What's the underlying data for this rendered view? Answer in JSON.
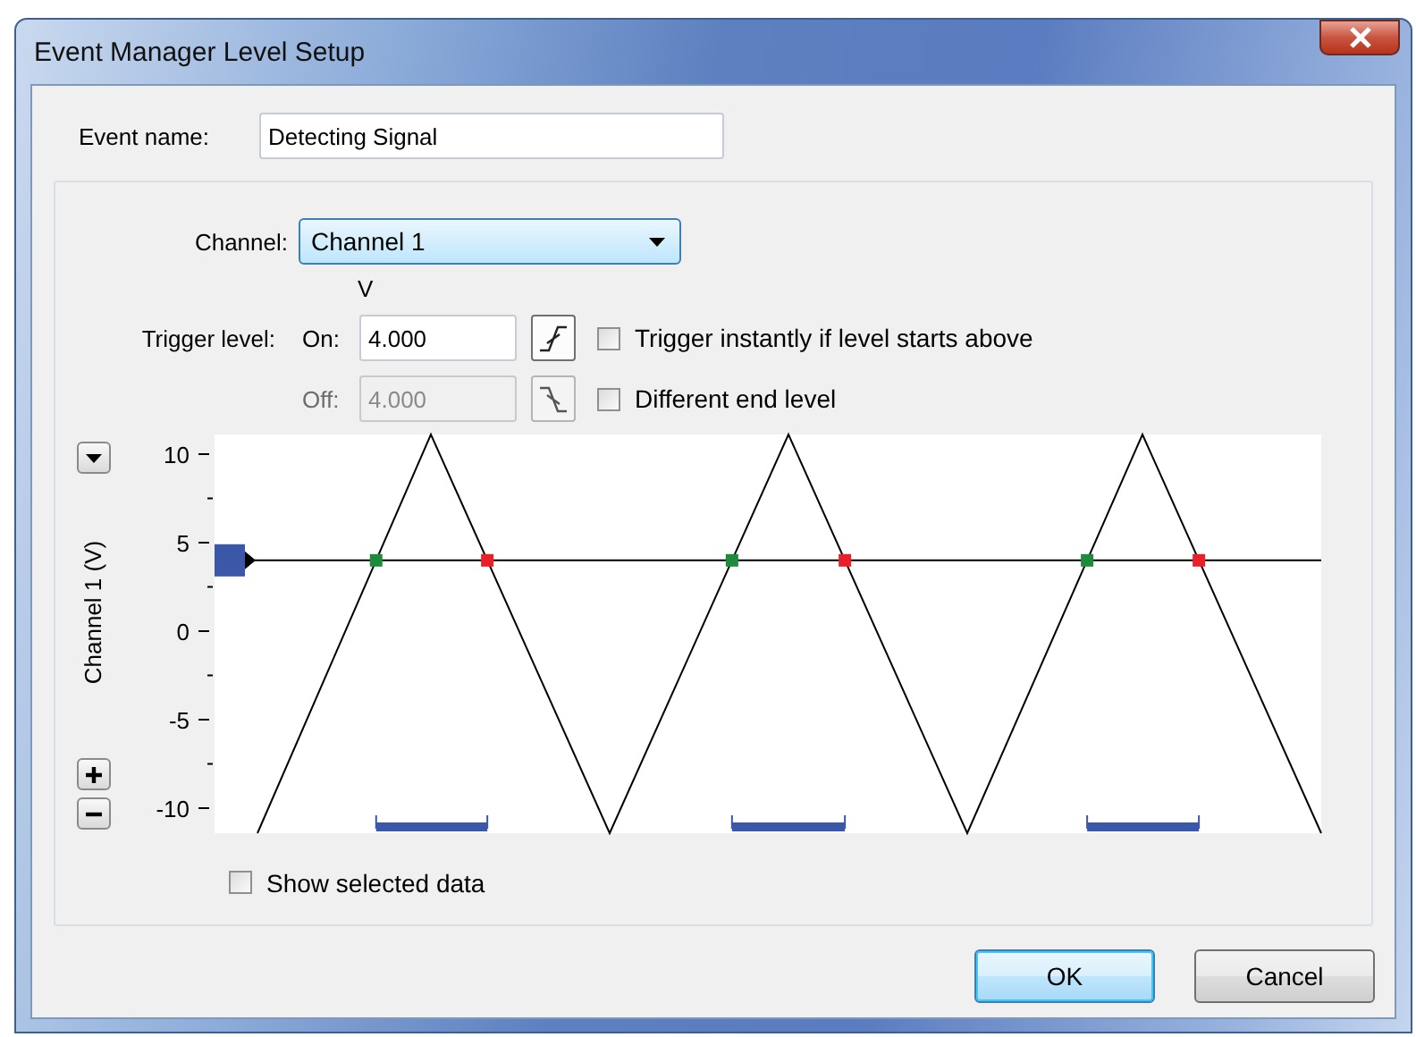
{
  "window": {
    "title": "Event Manager Level Setup"
  },
  "event_name": {
    "label": "Event name:",
    "value": "Detecting Signal"
  },
  "channel": {
    "label": "Channel:",
    "value": "Channel 1"
  },
  "trigger": {
    "unit": "V",
    "label": "Trigger level:",
    "on": {
      "label": "On:",
      "value": "4.000",
      "disabled": false
    },
    "off": {
      "label": "Off:",
      "value": "4.000",
      "disabled": true
    },
    "options": [
      {
        "label": "Trigger instantly if level starts above",
        "checked": false
      },
      {
        "label": "Different end level",
        "checked": false
      }
    ]
  },
  "chart": {
    "y_title": "Channel 1 (V)",
    "y_ticks": [
      "10",
      "5",
      "0",
      "-5",
      "-10"
    ]
  },
  "show_selected": {
    "label": "Show selected data",
    "checked": false
  },
  "buttons": [
    {
      "label": "OK",
      "default": true
    },
    {
      "label": "Cancel",
      "default": false
    }
  ]
}
